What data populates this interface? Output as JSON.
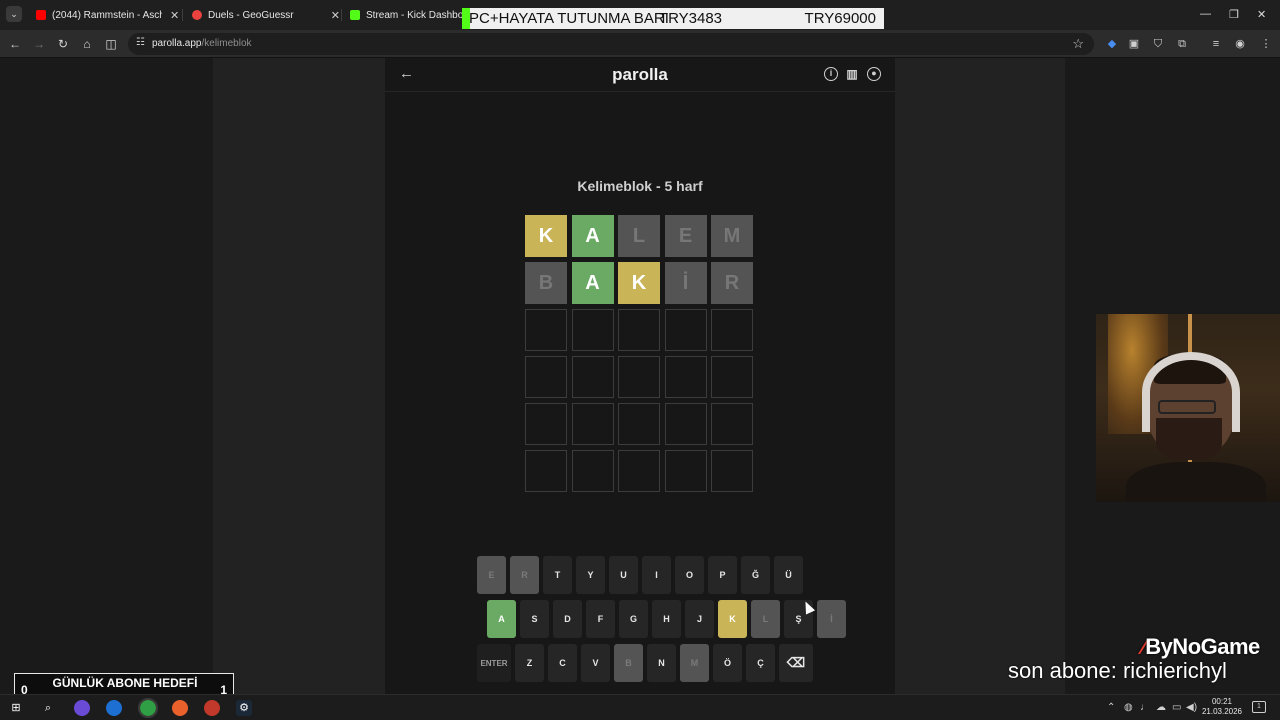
{
  "browser": {
    "tabs": [
      {
        "title": "(2044) Rammstein - Asche zu A",
        "favicon_color": "#ff0000",
        "icon": "youtube-icon"
      },
      {
        "title": "Duels - GeoGuessr",
        "favicon_color": "#e9423f",
        "icon": "pin-icon"
      },
      {
        "title": "Stream - Kick Dashboard",
        "favicon_color": "#53fc18",
        "icon": "kick-icon"
      }
    ],
    "url_host": "parolla.app",
    "url_path": "/kelimeblok"
  },
  "stream_banner": {
    "left_text": "PC+HAYATA TUTUNMA BARI",
    "mid_text": "TRY3483",
    "right_text": "TRY69000"
  },
  "app": {
    "logo": "parolla",
    "game_title": "Kelimeblok - 5 harf",
    "board": [
      [
        {
          "l": "K",
          "s": "present"
        },
        {
          "l": "A",
          "s": "correct"
        },
        {
          "l": "L",
          "s": "absent"
        },
        {
          "l": "E",
          "s": "absent"
        },
        {
          "l": "M",
          "s": "absent"
        }
      ],
      [
        {
          "l": "B",
          "s": "absent"
        },
        {
          "l": "A",
          "s": "correct"
        },
        {
          "l": "K",
          "s": "present"
        },
        {
          "l": "İ",
          "s": "absent"
        },
        {
          "l": "R",
          "s": "absent"
        }
      ],
      [
        {
          "l": "",
          "s": "empty"
        },
        {
          "l": "",
          "s": "empty"
        },
        {
          "l": "",
          "s": "empty"
        },
        {
          "l": "",
          "s": "empty"
        },
        {
          "l": "",
          "s": "empty"
        }
      ],
      [
        {
          "l": "",
          "s": "empty"
        },
        {
          "l": "",
          "s": "empty"
        },
        {
          "l": "",
          "s": "empty"
        },
        {
          "l": "",
          "s": "empty"
        },
        {
          "l": "",
          "s": "empty"
        }
      ],
      [
        {
          "l": "",
          "s": "empty"
        },
        {
          "l": "",
          "s": "empty"
        },
        {
          "l": "",
          "s": "empty"
        },
        {
          "l": "",
          "s": "empty"
        },
        {
          "l": "",
          "s": "empty"
        }
      ],
      [
        {
          "l": "",
          "s": "empty"
        },
        {
          "l": "",
          "s": "empty"
        },
        {
          "l": "",
          "s": "empty"
        },
        {
          "l": "",
          "s": "empty"
        },
        {
          "l": "",
          "s": "empty"
        }
      ]
    ],
    "keyboard": [
      [
        {
          "k": "E",
          "s": "absent"
        },
        {
          "k": "R",
          "s": "absent"
        },
        {
          "k": "T",
          "s": ""
        },
        {
          "k": "Y",
          "s": ""
        },
        {
          "k": "U",
          "s": ""
        },
        {
          "k": "I",
          "s": ""
        },
        {
          "k": "O",
          "s": ""
        },
        {
          "k": "P",
          "s": ""
        },
        {
          "k": "Ğ",
          "s": ""
        },
        {
          "k": "Ü",
          "s": ""
        }
      ],
      [
        {
          "k": "A",
          "s": "correct"
        },
        {
          "k": "S",
          "s": ""
        },
        {
          "k": "D",
          "s": ""
        },
        {
          "k": "F",
          "s": ""
        },
        {
          "k": "G",
          "s": ""
        },
        {
          "k": "H",
          "s": ""
        },
        {
          "k": "J",
          "s": ""
        },
        {
          "k": "K",
          "s": "present"
        },
        {
          "k": "L",
          "s": "absent"
        },
        {
          "k": "Ş",
          "s": ""
        },
        {
          "k": "İ",
          "s": "absent"
        }
      ],
      [
        {
          "k": "ENTER",
          "s": "wide"
        },
        {
          "k": "Z",
          "s": ""
        },
        {
          "k": "C",
          "s": ""
        },
        {
          "k": "V",
          "s": ""
        },
        {
          "k": "B",
          "s": "absent"
        },
        {
          "k": "N",
          "s": ""
        },
        {
          "k": "M",
          "s": "absent"
        },
        {
          "k": "Ö",
          "s": ""
        },
        {
          "k": "Ç",
          "s": ""
        },
        {
          "k": "⌫",
          "s": "back"
        }
      ]
    ]
  },
  "overlays": {
    "brand": "ByNoGame",
    "son_abone": "son abone: richierichyl",
    "goal_label": "GÜNLÜK ABONE HEDEFİ",
    "goal_current": "0",
    "goal_target": "1"
  },
  "taskbar": {
    "time": "00:21",
    "date": "21.03.2026"
  }
}
